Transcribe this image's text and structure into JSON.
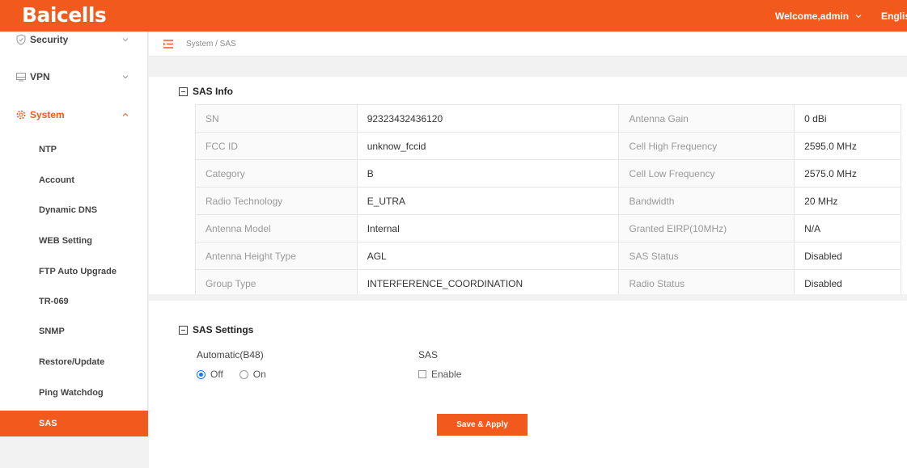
{
  "header": {
    "logo": "Baicells",
    "welcome": "Welcome,admin",
    "language": "Englis"
  },
  "sidebar": {
    "groups": [
      {
        "label": "Security",
        "icon": "shield-icon",
        "expanded": false
      },
      {
        "label": "VPN",
        "icon": "monitor-icon",
        "expanded": false
      },
      {
        "label": "System",
        "icon": "gear-icon",
        "expanded": true
      }
    ],
    "items": [
      {
        "label": "NTP"
      },
      {
        "label": "Account"
      },
      {
        "label": "Dynamic DNS"
      },
      {
        "label": "WEB Setting"
      },
      {
        "label": "FTP Auto Upgrade"
      },
      {
        "label": "TR-069"
      },
      {
        "label": "SNMP"
      },
      {
        "label": "Restore/Update"
      },
      {
        "label": "Ping Watchdog"
      },
      {
        "label": "SAS",
        "active": true
      }
    ]
  },
  "breadcrumb": "System / SAS",
  "sas_info": {
    "title": "SAS Info",
    "rows": [
      {
        "k1": "SN",
        "v1": "92323432436120",
        "k2": "Antenna Gain",
        "v2": "0 dBi"
      },
      {
        "k1": "FCC ID",
        "v1": "unknow_fccid",
        "k2": "Cell High Frequency",
        "v2": "2595.0 MHz"
      },
      {
        "k1": "Category",
        "v1": "B",
        "k2": "Cell Low Frequency",
        "v2": "2575.0 MHz"
      },
      {
        "k1": "Radio Technology",
        "v1": "E_UTRA",
        "k2": "Bandwidth",
        "v2": "20 MHz"
      },
      {
        "k1": "Antenna Model",
        "v1": "Internal",
        "k2": "Granted EIRP(10MHz)",
        "v2": "N/A"
      },
      {
        "k1": "Antenna Height Type",
        "v1": "AGL",
        "k2": "SAS Status",
        "v2": "Disabled"
      },
      {
        "k1": "Group Type",
        "v1": "INTERFERENCE_COORDINATION",
        "k2": "Radio Status",
        "v2": "Disabled"
      }
    ]
  },
  "sas_settings": {
    "title": "SAS Settings",
    "automatic_label": "Automatic(B48)",
    "off_label": "Off",
    "on_label": "On",
    "selected": "Off",
    "sas_label": "SAS",
    "enable_label": "Enable",
    "enable_checked": false
  },
  "save_label": "Save & Apply",
  "colors": {
    "accent": "#f25a1d",
    "radio": "#1677ff"
  }
}
